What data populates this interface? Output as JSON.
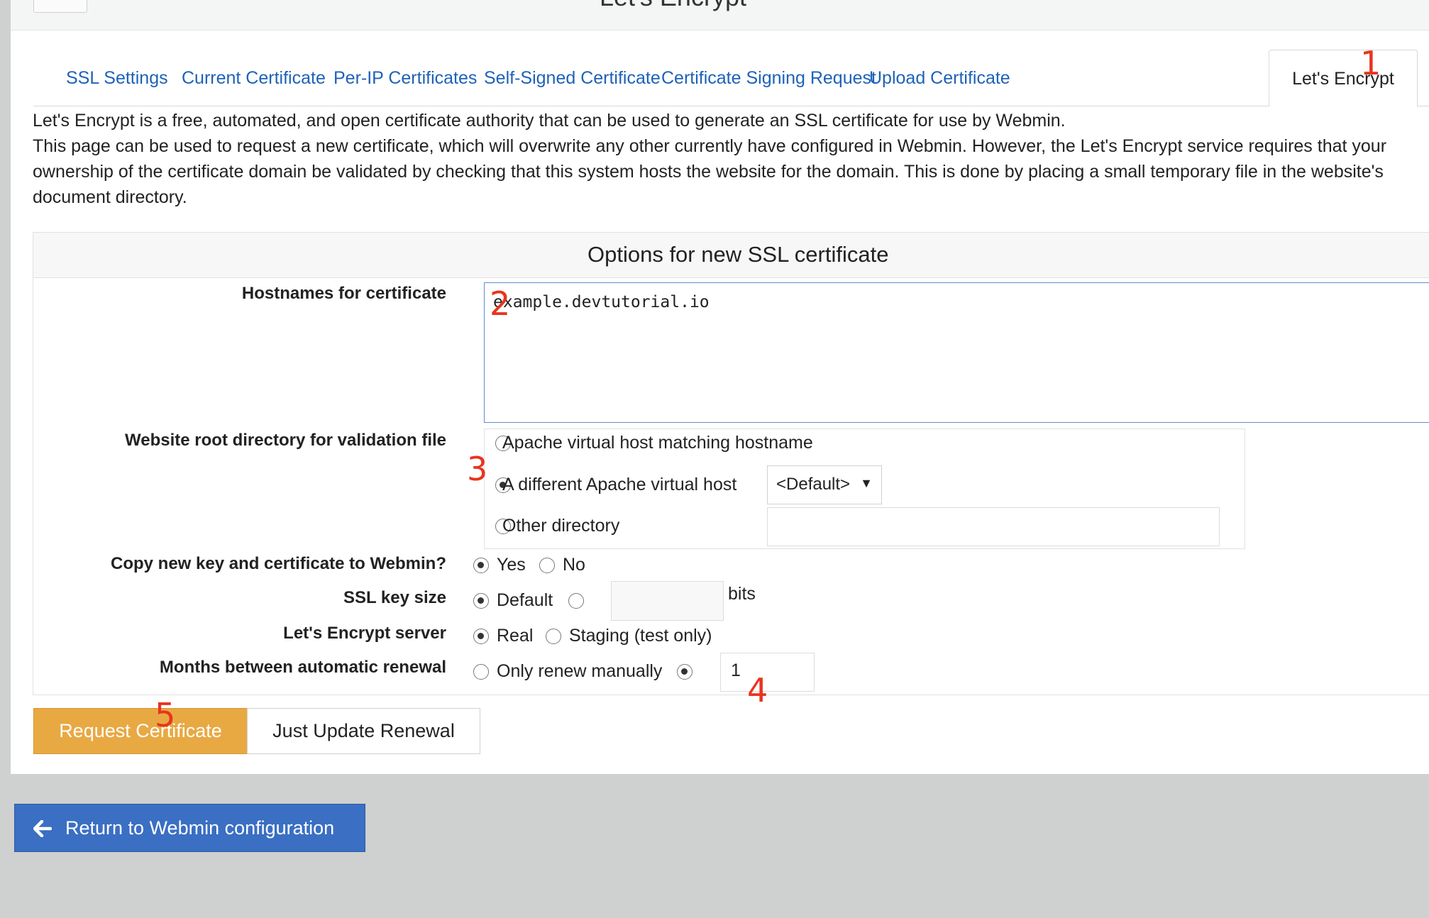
{
  "header": {
    "title": "Let's Encrypt"
  },
  "tabs": [
    {
      "label": "SSL Settings"
    },
    {
      "label": "Current Certificate"
    },
    {
      "label": "Per-IP Certificates"
    },
    {
      "label": "Self-Signed Certificate"
    },
    {
      "label": "Certificate Signing Request"
    },
    {
      "label": "Upload Certificate"
    },
    {
      "label": "Let's Encrypt",
      "active": true
    }
  ],
  "intro": {
    "line1": "Let's Encrypt is a free, automated, and open certificate authority that can be used to generate an SSL certificate for use by Webmin.",
    "line2": "This page can be used to request a new certificate, which will overwrite any other currently have configured in Webmin. However, the Let's Encrypt service requires that your",
    "line3": "ownership of the certificate domain be validated by checking that this system hosts the website for the domain. This is done by placing a small temporary file in the website's",
    "line4": "document directory."
  },
  "options": {
    "title": "Options for new SSL certificate",
    "hostnames": {
      "label": "Hostnames for certificate",
      "value": "example.devtutorial.io"
    },
    "webroot": {
      "label": "Website root directory for validation file",
      "option_apache_match": "Apache virtual host matching hostname",
      "option_apache_other": "A different Apache virtual host",
      "option_other_dir": "Other directory",
      "selected": "option_apache_other",
      "vhost_select": "<Default>",
      "other_dir_value": ""
    },
    "copy_to_webmin": {
      "label": "Copy new key and certificate to Webmin?",
      "yes": "Yes",
      "no": "No",
      "selected": "yes"
    },
    "key_size": {
      "label": "SSL key size",
      "default": "Default",
      "custom_value": "",
      "unit": "bits",
      "selected": "default"
    },
    "server": {
      "label": "Let's Encrypt server",
      "real": "Real",
      "staging": "Staging (test only)",
      "selected": "real"
    },
    "renewal": {
      "label": "Months between automatic renewal",
      "manual": "Only renew manually",
      "months_value": "1",
      "selected": "months"
    }
  },
  "actions": {
    "request": "Request Certificate",
    "renewal": "Just Update Renewal"
  },
  "footer": {
    "return": "Return to Webmin configuration"
  },
  "annotations": [
    "1",
    "2",
    "3",
    "4",
    "5"
  ],
  "colors": {
    "link": "#1e62b8",
    "request_button": "#e8a943",
    "return_button": "#3a6fc3",
    "annotation": "#e8341f"
  }
}
